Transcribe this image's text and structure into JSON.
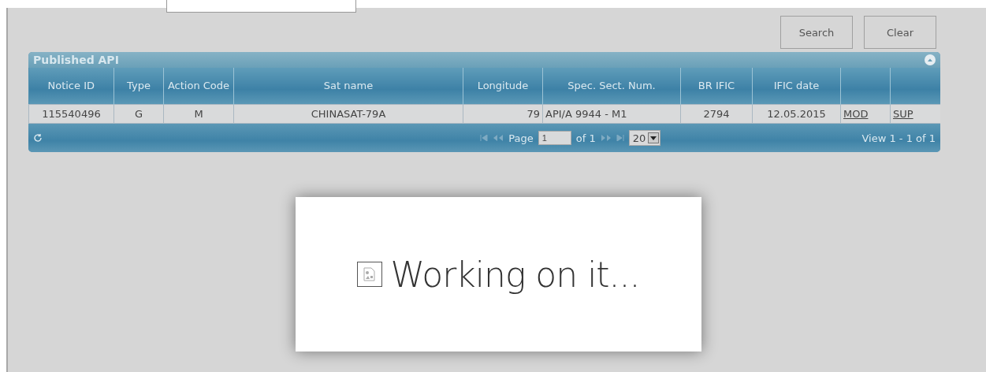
{
  "buttons": [
    "Search",
    "Clear"
  ],
  "grid": {
    "title": "Published API",
    "columns": [
      "Notice ID",
      "Type",
      "Action Code",
      "Sat name",
      "Longitude",
      "Spec. Sect. Num.",
      "BR IFIC",
      "IFIC date",
      "",
      ""
    ],
    "rows": [
      {
        "cells": [
          "115540496",
          "G",
          "M",
          "CHINASAT-79A",
          "79",
          "API/A 9944 - M1",
          "2794",
          "12.05.2015",
          "MOD",
          "SUP"
        ]
      }
    ],
    "pager": {
      "page_label": "Page",
      "page": "1",
      "of": "of 1",
      "page_size": "20",
      "view": "View 1 - 1 of 1"
    }
  },
  "overlay": {
    "message": "Working on it..."
  }
}
